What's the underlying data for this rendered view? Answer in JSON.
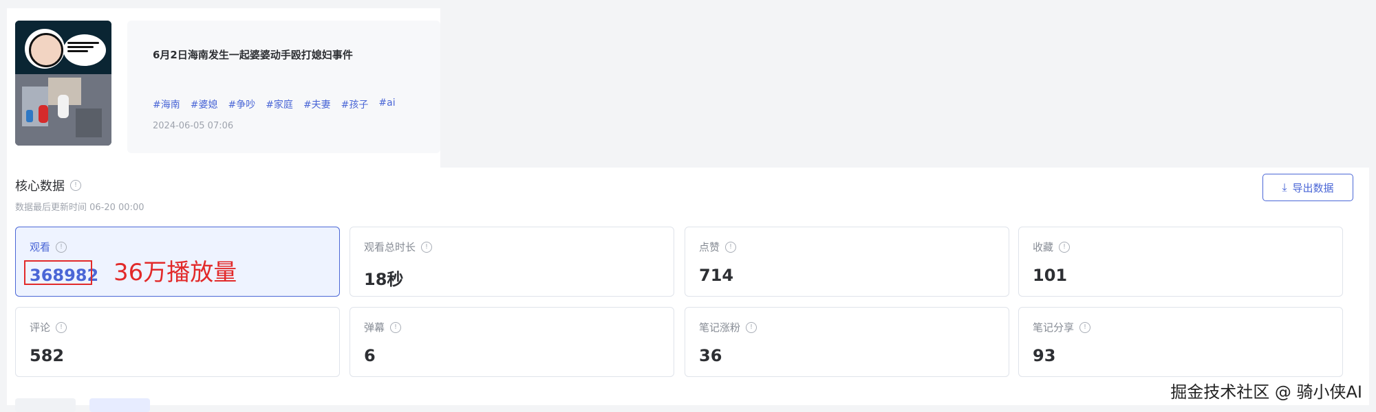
{
  "note": {
    "title": "6月2日海南发生一起婆婆动手殴打媳妇事件",
    "tags": [
      "#海南",
      "#婆媳",
      "#争吵",
      "#家庭",
      "#夫妻",
      "#孩子",
      "#ai"
    ],
    "timestamp": "2024-06-05 07:06"
  },
  "core": {
    "title": "核心数据",
    "updated": "数据最后更新时间 06-20 00:00",
    "export_label": "导出数据"
  },
  "metrics": [
    {
      "label": "观看",
      "value": "368982"
    },
    {
      "label": "观看总时长",
      "value": "18秒"
    },
    {
      "label": "点赞",
      "value": "714"
    },
    {
      "label": "收藏",
      "value": "101"
    },
    {
      "label": "评论",
      "value": "582"
    },
    {
      "label": "弹幕",
      "value": "6"
    },
    {
      "label": "笔记涨粉",
      "value": "36"
    },
    {
      "label": "笔记分享",
      "value": "93"
    }
  ],
  "annotation": "36万播放量",
  "watermark": "掘金技术社区 @ 骑小侠AI",
  "colors": {
    "accent": "#4a66d6",
    "highlight_bg": "#eef3ff",
    "annotation": "#e22929"
  },
  "icons": {
    "info": "info-circle-icon",
    "export": "download-icon"
  }
}
